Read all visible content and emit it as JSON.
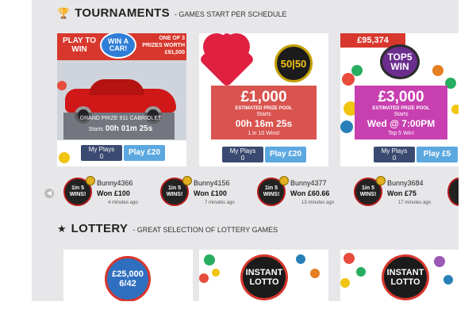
{
  "tournaments": {
    "title": "TOURNAMENTS",
    "subtitle": "- GAMES START PER SCHEDULE",
    "cards": [
      {
        "badge": "PLAY TO WIN",
        "logo": "WIN A CAR!",
        "promo": "ONE OF 3 PRIZES WORTH £91,000",
        "grand_prize": "GRAND PRIZE 911 CABRIOLET",
        "starts_label": "Starts",
        "countdown": "00h 01m 25s",
        "my_plays_label": "My Plays",
        "my_plays_value": "0",
        "play_label": "Play £20"
      },
      {
        "logo": "50|50",
        "prize": "£1,000",
        "prize_caption": "ESTIMATED PRIZE POOL",
        "starts_label": "Starts",
        "countdown": "00h 16m 25s",
        "odds": "1 in 10 Wins!",
        "my_plays_label": "My Plays",
        "my_plays_value": "0",
        "play_label": "Play £20"
      },
      {
        "jackpot": "£95,374",
        "logo": "TOP5 WIN",
        "prize": "£3,000",
        "prize_caption": "ESTIMATED PRIZE POOL",
        "starts_label": "Starts",
        "countdown": "Wed @ 7:00PM",
        "odds": "Top 5 Win!",
        "my_plays_label": "My Plays",
        "my_plays_value": "0",
        "play_label": "Play £5"
      }
    ]
  },
  "winners": {
    "logo_text": "1in 5 WINS!",
    "items": [
      {
        "name": "Bunny4366",
        "won": "Won £100",
        "ago": "4 minutes ago"
      },
      {
        "name": "Bunny4156",
        "won": "Won £100",
        "ago": "7 minutes ago"
      },
      {
        "name": "Bunny4377",
        "won": "Won £60.66",
        "ago": "13 minutes ago"
      },
      {
        "name": "Bunny3684",
        "won": "Won £75",
        "ago": "17 minutes ago"
      }
    ]
  },
  "lottery": {
    "title": "LOTTERY",
    "subtitle": "- GREAT SELECTION OF LOTTERY GAMES",
    "cards": [
      {
        "logo_top": "£25,000",
        "logo_bottom": "6/42"
      },
      {
        "logo_top": "INSTANT",
        "logo_bottom": "LOTTO"
      },
      {
        "logo_top": "INSTANT",
        "logo_bottom": "LOTTO"
      }
    ]
  },
  "colors": {
    "accent_red": "#d9534f",
    "play_blue": "#5ba8e0",
    "navy": "#3a4a70",
    "magenta": "#c83fb0"
  },
  "icons": {
    "tournaments": "trophy-icon",
    "lottery": "star-icon",
    "prev": "chevron-left-icon"
  }
}
